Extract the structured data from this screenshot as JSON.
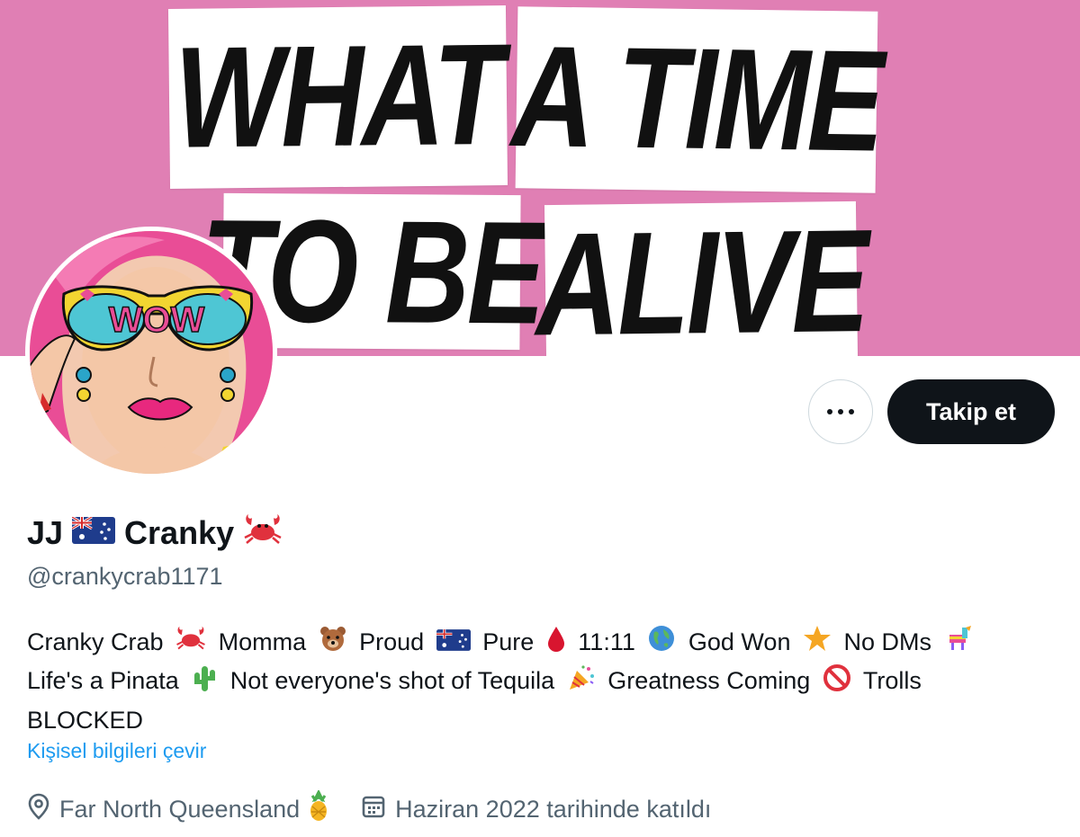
{
  "banner": {
    "line1_left": "WHAT",
    "line1_right": "A TIME",
    "line2_left": "TO BE",
    "line2_right": "ALIVE",
    "background_color": "#e07fb4"
  },
  "avatar": {
    "glasses_text": "WOW"
  },
  "actions": {
    "more_icon": "more-dots-icon",
    "follow_label": "Takip et"
  },
  "profile": {
    "name_part1": "JJ",
    "name_part2": "Cranky",
    "name_icons": [
      "australia-flag-icon",
      "crab-icon"
    ],
    "handle": "@crankycrab1171"
  },
  "bio": {
    "segments": [
      "Cranky Crab",
      "Momma",
      "Proud",
      "Pure",
      "11:11",
      "God Won",
      "No DMs",
      "Life's a Pinata",
      "Not everyone's shot of Tequila",
      "Greatness Coming",
      "Trolls",
      "BLOCKED"
    ],
    "icons": [
      "crab-icon",
      "bear-icon",
      "australia-flag-icon",
      "drop-icon",
      "globe-icon",
      "star-icon",
      "pinata-icon",
      "cactus-icon",
      "party-popper-icon",
      "prohibited-icon"
    ]
  },
  "translate_label": "Kişisel bilgileri çevir",
  "meta": {
    "location": "Far North Queensland",
    "location_icon": "location-pin-icon",
    "location_emoji_icon": "pineapple-icon",
    "joined": "Haziran 2022 tarihinde katıldı",
    "joined_icon": "calendar-icon"
  },
  "colors": {
    "accent": "#1d9bf0",
    "secondary_text": "#536471",
    "primary_text": "#0f1419",
    "follow_button": "#0f1419"
  }
}
